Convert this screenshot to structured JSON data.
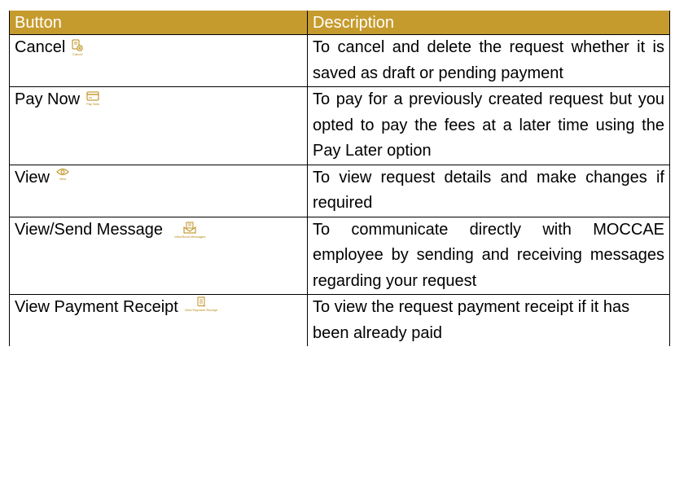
{
  "table": {
    "header": {
      "button": "Button",
      "description": "Description"
    },
    "rows": [
      {
        "button": "Cancel",
        "icon": "cancel-document-icon",
        "icon_caption": "Cancel",
        "description": "To cancel and delete the request whether it is saved as draft or pending payment"
      },
      {
        "button": "Pay Now",
        "icon": "credit-card-icon",
        "icon_caption": "Pay Now",
        "description": "To pay for a previously created request but you opted to pay the fees at a later time using the Pay Later option"
      },
      {
        "button": "View",
        "icon": "eye-icon",
        "icon_caption": "View",
        "description": "To view request details and make changes if required"
      },
      {
        "button": "View/Send Message",
        "icon": "message-envelope-icon",
        "icon_caption": "View/Send Messages",
        "description": "To communicate directly with MOCCAE employee by sending and receiving messages regarding your request"
      },
      {
        "button": "View Payment Receipt",
        "icon": "receipt-icon",
        "icon_caption": "View Payment Receipt",
        "description": "To view the request payment receipt if it has been already paid"
      }
    ]
  },
  "colors": {
    "header_background": "#c69b2d",
    "header_text": "#ffffff",
    "icon_accent": "#b8860b",
    "border": "#000000"
  }
}
